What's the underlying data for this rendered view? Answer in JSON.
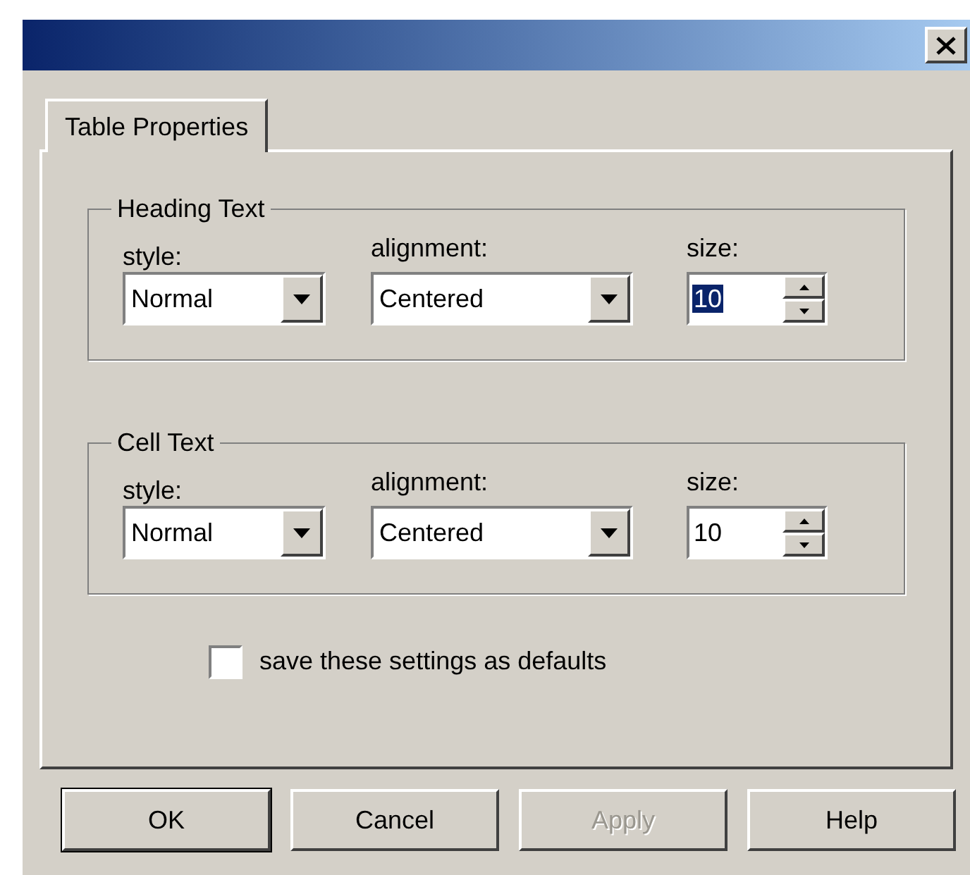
{
  "tabs": [
    {
      "label": "Table Properties",
      "selected": true
    }
  ],
  "groups": [
    {
      "title": "Heading Text",
      "style_label": "style:",
      "style": "Normal",
      "alignment_label": "alignment:",
      "alignment": "Centered",
      "size_label": "size:",
      "size": "10",
      "size_highlighted": true
    },
    {
      "title": "Cell Text",
      "style_label": "style:",
      "style": "Normal",
      "alignment_label": "alignment:",
      "alignment": "Centered",
      "size_label": "size:",
      "size": "10",
      "size_highlighted": false
    }
  ],
  "checkbox": {
    "label": "save these settings as defaults",
    "checked": false
  },
  "buttons": [
    {
      "label": "OK",
      "default": true,
      "disabled": false
    },
    {
      "label": "Cancel",
      "default": false,
      "disabled": false
    },
    {
      "label": "Apply",
      "default": false,
      "disabled": true
    },
    {
      "label": "Help",
      "default": false,
      "disabled": false
    }
  ]
}
